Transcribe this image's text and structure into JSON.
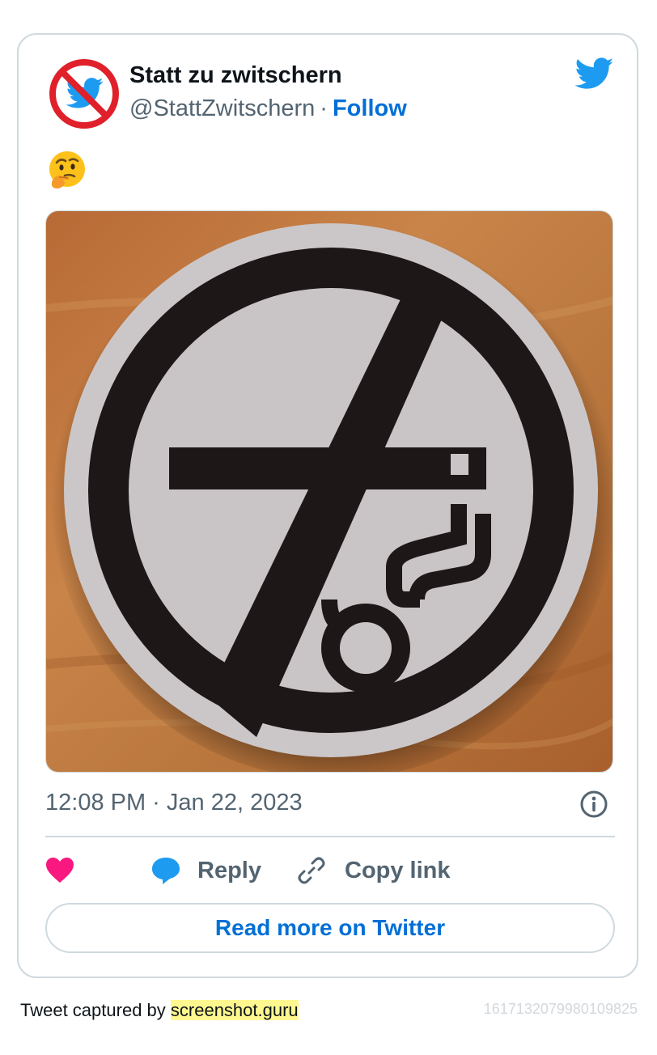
{
  "tweet": {
    "display_name": "Statt zu zwitschern",
    "handle": "@StattZwitschern",
    "separator": "·",
    "follow_label": "Follow",
    "text_emoji_icon": "thinking-face-emoji",
    "media_description_icon": "no-smoking-sign-photo",
    "timestamp": "12:08 PM · Jan 22, 2023"
  },
  "actions": {
    "like_icon": "heart-icon",
    "reply_label": "Reply",
    "copy_link_label": "Copy link"
  },
  "read_more_label": "Read more on Twitter",
  "footer": {
    "prefix": "Tweet captured by ",
    "brand": "screenshot.guru",
    "tweet_id": "1617132079980109825"
  },
  "colors": {
    "link_blue": "#006fd6",
    "twitter_blue": "#1d9bf0",
    "like_pink": "#f91880",
    "muted_text": "#536471",
    "border": "#cfd9de",
    "highlight": "#fff88f"
  }
}
